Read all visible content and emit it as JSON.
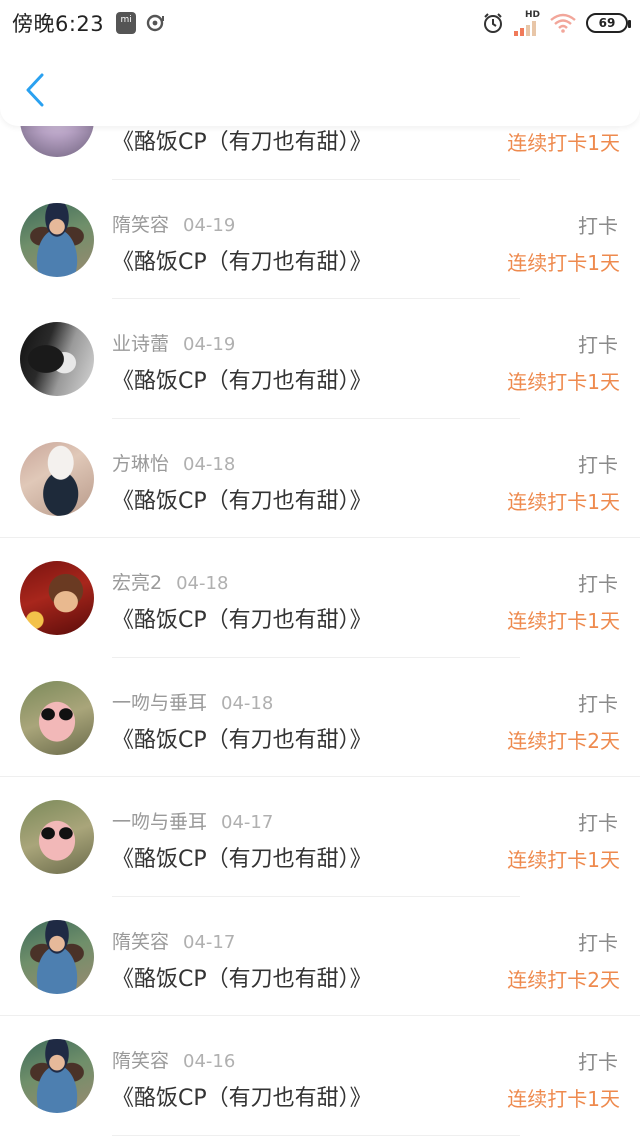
{
  "status_bar": {
    "time": "傍晚6:23",
    "network": "HD",
    "battery": "69"
  },
  "colors": {
    "accent_orange": "#ee8a4e",
    "back_blue": "#2aa1f0"
  },
  "records": [
    {
      "username": "",
      "date": "",
      "title": "《酪饭CP（有刀也有甜）》",
      "action": "",
      "streak": "连续打卡1天",
      "avatar": "avatar-partial"
    },
    {
      "username": "隋笑容",
      "date": "04-19",
      "title": "《酪饭CP（有刀也有甜）》",
      "action": "打卡",
      "streak": "连续打卡1天",
      "avatar": "avatar-girl-hat"
    },
    {
      "username": "业诗蕾",
      "date": "04-19",
      "title": "《酪饭CP（有刀也有甜）》",
      "action": "打卡",
      "streak": "连续打卡1天",
      "avatar": "avatar-smoker-bw"
    },
    {
      "username": "方琳怡",
      "date": "04-18",
      "title": "《酪饭CP（有刀也有甜）》",
      "action": "打卡",
      "streak": "连续打卡1天",
      "avatar": "avatar-white-hat"
    },
    {
      "username": "宏亮2",
      "date": "04-18",
      "title": "《酪饭CP（有刀也有甜）》",
      "action": "打卡",
      "streak": "连续打卡1天",
      "avatar": "avatar-red-festive"
    },
    {
      "username": "一吻与垂耳",
      "date": "04-18",
      "title": "《酪饭CP（有刀也有甜）》",
      "action": "打卡",
      "streak": "连续打卡2天",
      "avatar": "avatar-pig-sunglasses"
    },
    {
      "username": "一吻与垂耳",
      "date": "04-17",
      "title": "《酪饭CP（有刀也有甜）》",
      "action": "打卡",
      "streak": "连续打卡1天",
      "avatar": "avatar-pig-sunglasses"
    },
    {
      "username": "隋笑容",
      "date": "04-17",
      "title": "《酪饭CP（有刀也有甜）》",
      "action": "打卡",
      "streak": "连续打卡2天",
      "avatar": "avatar-girl-hat"
    },
    {
      "username": "隋笑容",
      "date": "04-16",
      "title": "《酪饭CP（有刀也有甜）》",
      "action": "打卡",
      "streak": "连续打卡1天",
      "avatar": "avatar-girl-hat"
    }
  ]
}
